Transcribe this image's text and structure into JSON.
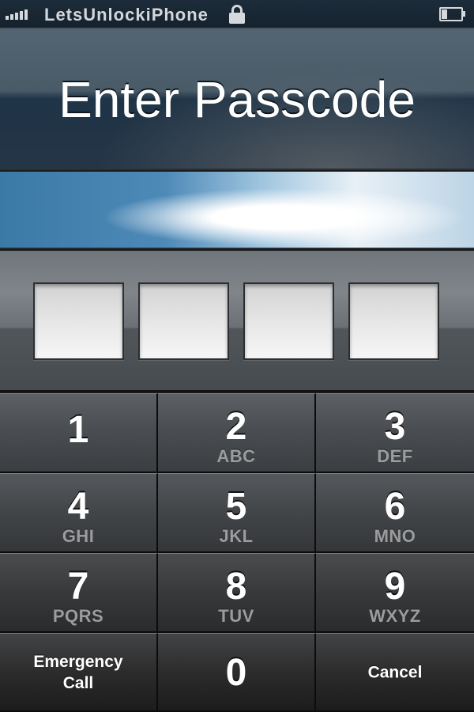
{
  "status_bar": {
    "carrier": "LetsUnlockiPhone",
    "signal_bars": 5,
    "lock_icon": "lock-icon",
    "battery_level": 0.3
  },
  "header": {
    "title": "Enter Passcode"
  },
  "passcode": {
    "length": 4,
    "entered": 0
  },
  "keypad": {
    "keys": [
      {
        "digit": "1",
        "letters": ""
      },
      {
        "digit": "2",
        "letters": "ABC"
      },
      {
        "digit": "3",
        "letters": "DEF"
      },
      {
        "digit": "4",
        "letters": "GHI"
      },
      {
        "digit": "5",
        "letters": "JKL"
      },
      {
        "digit": "6",
        "letters": "MNO"
      },
      {
        "digit": "7",
        "letters": "PQRS"
      },
      {
        "digit": "8",
        "letters": "TUV"
      },
      {
        "digit": "9",
        "letters": "WXYZ"
      }
    ],
    "emergency_label": "Emergency\nCall",
    "zero": {
      "digit": "0"
    },
    "cancel_label": "Cancel"
  }
}
